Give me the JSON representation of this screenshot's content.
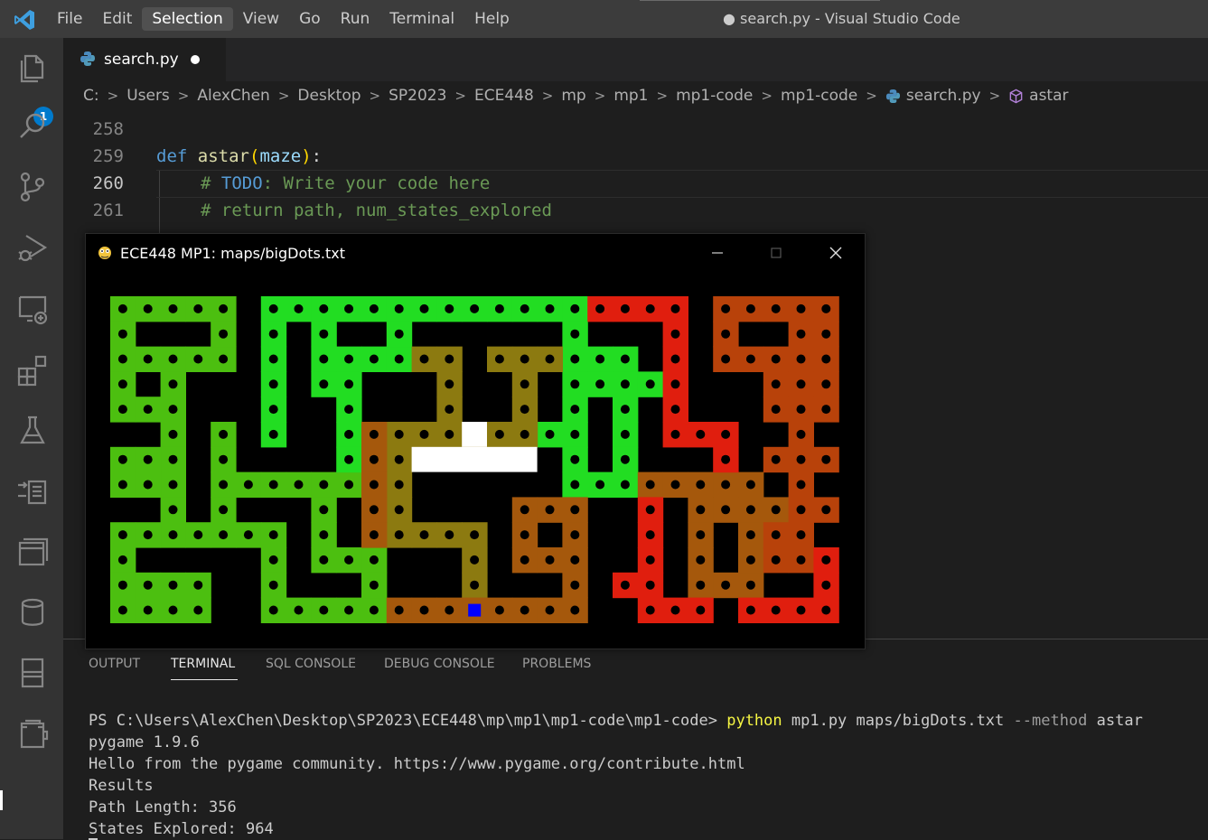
{
  "app": {
    "window_title": "● search.py - Visual Studio Code",
    "menu": [
      "File",
      "Edit",
      "Selection",
      "View",
      "Go",
      "Run",
      "Terminal",
      "Help"
    ],
    "menu_active": "Selection"
  },
  "activity_bar": {
    "items": [
      "explorer-icon",
      "search-icon",
      "source-control-icon",
      "run-debug-icon",
      "remote-explorer-icon",
      "extensions-icon",
      "testing-icon",
      "test-export-icon",
      "pull-request-icon",
      "database-icon",
      "notebook-icon",
      "docker-icon"
    ],
    "explorer_badge": "1"
  },
  "editor": {
    "tab": {
      "filename": "search.py",
      "modified": true
    },
    "breadcrumb": [
      "C:",
      "Users",
      "AlexChen",
      "Desktop",
      "SP2023",
      "ECE448",
      "mp",
      "mp1",
      "mp1-code",
      "mp1-code",
      "search.py",
      "astar"
    ],
    "current_line": "260",
    "lines": [
      {
        "number": "258"
      },
      {
        "number": "259",
        "def": "def",
        "name": "astar",
        "open": "(",
        "param": "maze",
        "close": ")",
        "colon": ":"
      },
      {
        "number": "260",
        "hash": "# ",
        "todo": "TODO",
        "rest": ": Write your code here"
      },
      {
        "number": "261",
        "comment": "# return path, num_states_explored"
      }
    ]
  },
  "game_window": {
    "title": "ECE448 MP1: maps/bigDots.txt",
    "colors": {
      "background": "#000000",
      "wall": "#000000",
      "dot": "#000000",
      "agent": "#0000ff",
      "white_block": "#ffffff"
    }
  },
  "panel": {
    "tabs": [
      "OUTPUT",
      "TERMINAL",
      "SQL CONSOLE",
      "DEBUG CONSOLE",
      "PROBLEMS"
    ],
    "active_tab": "TERMINAL",
    "terminal": {
      "prompt": "PS C:\\Users\\AlexChen\\Desktop\\SP2023\\ECE448\\mp\\mp1\\mp1-code\\mp1-code> ",
      "command": "python",
      "arg1": " mp1.py maps/bigDots.txt ",
      "flag": "--method",
      "arg2": " astar",
      "output": [
        "pygame 1.9.6",
        "Hello from the pygame community. https://www.pygame.org/contribute.html",
        "Results",
        "Path Length: 356",
        "States Explored: 964"
      ]
    }
  }
}
